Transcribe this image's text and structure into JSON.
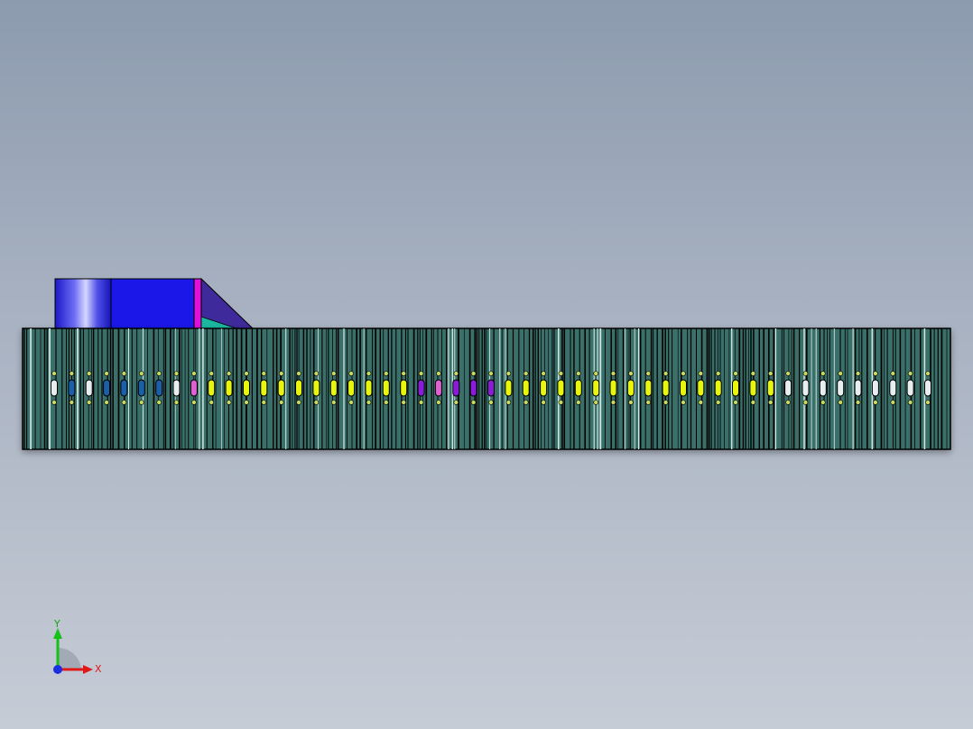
{
  "view": {
    "background_top": "#8d9baf",
    "background_bottom": "#c6ccd6"
  },
  "model": {
    "body_color": "#3a6f6a",
    "top_block_color": "#1a17e8",
    "accent_color": "#e010d8",
    "ramp_color": "#3e2a9a",
    "slot_colors": {
      "lit": "#e8f50a",
      "purple": "#8a1fd8",
      "pink": "#e060d0",
      "blue": "#1d5fa8",
      "white": "#e8eef0"
    },
    "slot_pattern": [
      "white",
      "blue",
      "white",
      "blue",
      "blue",
      "blue",
      "blue",
      "white",
      "pink",
      "lit",
      "lit",
      "lit",
      "lit",
      "lit",
      "lit",
      "lit",
      "lit",
      "lit",
      "lit",
      "lit",
      "lit",
      "purple",
      "pink",
      "purple",
      "purple",
      "purple",
      "lit",
      "lit",
      "lit",
      "lit",
      "lit",
      "lit",
      "lit",
      "lit",
      "lit",
      "lit",
      "lit",
      "lit",
      "lit",
      "lit",
      "lit",
      "lit",
      "white",
      "white",
      "white",
      "white",
      "white",
      "white",
      "white",
      "white",
      "white"
    ]
  },
  "triad": {
    "x_label": "X",
    "y_label": "Y",
    "x_color": "#e01818",
    "y_color": "#18c018",
    "z_color": "#1830e0"
  }
}
